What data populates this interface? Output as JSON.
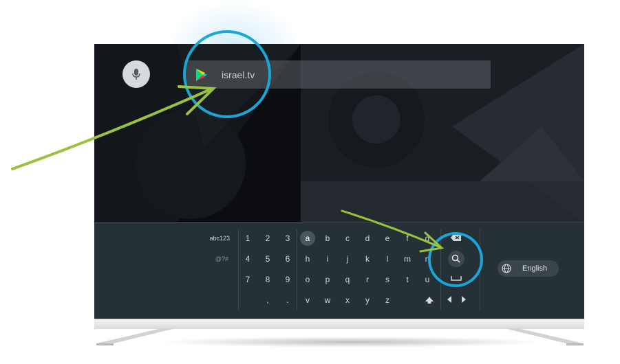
{
  "search": {
    "query": "israel.tv"
  },
  "keyboard": {
    "modes": [
      "abc123",
      "@?#"
    ],
    "rows": [
      [
        "1",
        "2",
        "3",
        "a",
        "b",
        "c",
        "d",
        "e",
        "f",
        "g"
      ],
      [
        "4",
        "5",
        "6",
        "h",
        "i",
        "j",
        "k",
        "l",
        "m",
        "n"
      ],
      [
        "7",
        "8",
        "9",
        "o",
        "p",
        "q",
        "r",
        "s",
        "t",
        "u"
      ],
      [
        "",
        ",",
        ".",
        "v",
        "w",
        "x",
        "y",
        "z"
      ]
    ],
    "selected_key": "a",
    "language": "English"
  },
  "icons": {
    "mic": "mic-icon",
    "store": "play-store-icon",
    "backspace": "backspace-icon",
    "search": "search-icon",
    "space": "space-icon",
    "shift": "shift-icon",
    "left": "arrow-left-icon",
    "right": "arrow-right-icon",
    "globe": "globe-icon"
  },
  "colors": {
    "highlight_ring": "#1aa6d6",
    "arrow": "#9ac23c",
    "keyboard_bg": "#253037"
  }
}
